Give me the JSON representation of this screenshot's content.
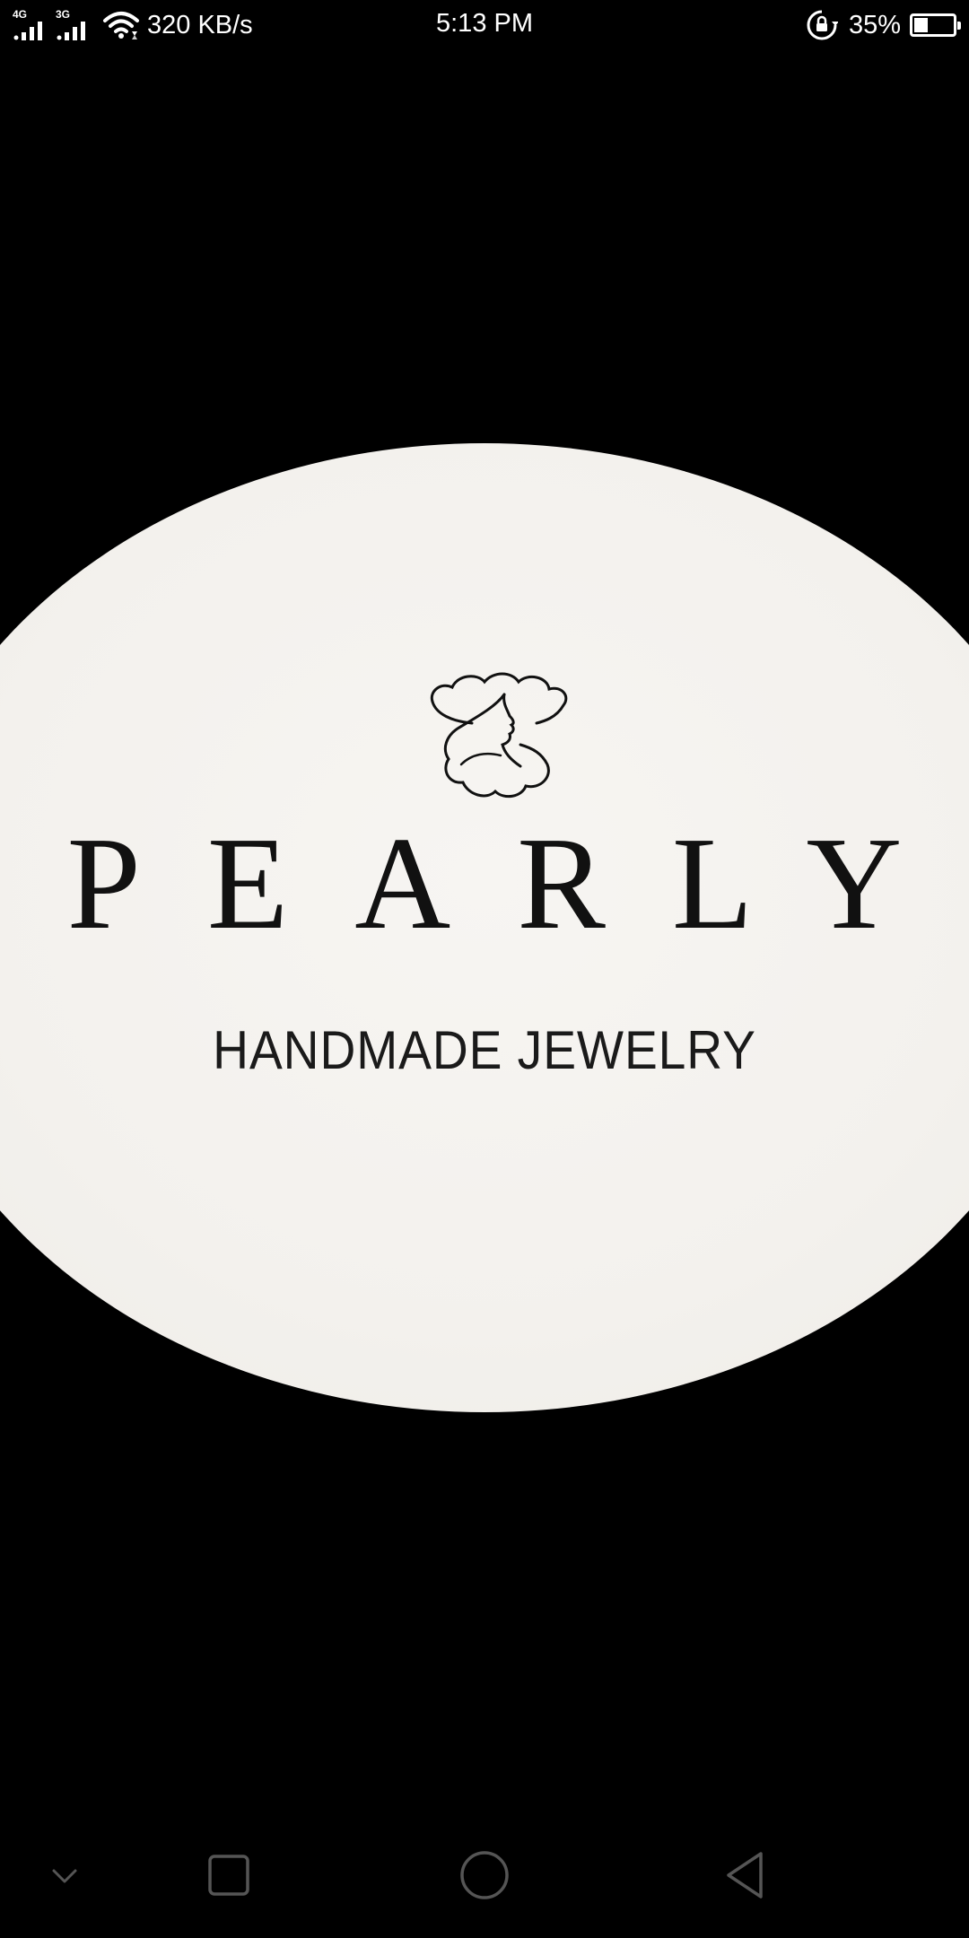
{
  "status_bar": {
    "signal_1_tag": "4G",
    "signal_2_tag": "3G",
    "net_speed": "320 KB/s",
    "time": "5:13 PM",
    "battery_percent": "35%",
    "battery_level": 0.35,
    "icons": [
      "signal-4g-icon",
      "signal-3g-icon",
      "wifi-icon",
      "rotation-lock-icon",
      "battery-icon"
    ]
  },
  "logo": {
    "brand": "PEARLY",
    "tagline": "HANDMADE JEWELRY",
    "icon": "pearl-shell-face-icon",
    "colors": {
      "background": "#000000",
      "ellipse": "#f5f3f0",
      "ink": "#111111"
    }
  },
  "nav_bar": {
    "buttons": [
      "collapse-icon",
      "recents-icon",
      "home-icon",
      "back-icon"
    ]
  }
}
